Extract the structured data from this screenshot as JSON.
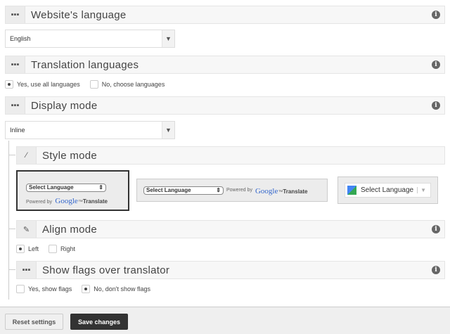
{
  "sections": {
    "website_language": {
      "title": "Website's language",
      "value": "English"
    },
    "translation_languages": {
      "title": "Translation languages",
      "options": [
        "Yes, use all languages",
        "No, choose languages"
      ]
    },
    "display_mode": {
      "title": "Display mode",
      "value": "Inline"
    },
    "style_mode": {
      "title": "Style mode",
      "select_label": "Select Language",
      "powered_by": "Powered by",
      "google": "Google",
      "tm": "™",
      "translate": "Translate"
    },
    "align_mode": {
      "title": "Align mode",
      "options": [
        "Left",
        "Right"
      ]
    },
    "show_flags": {
      "title": "Show flags over translator",
      "options": [
        "Yes, show flags",
        "No, don't show flags"
      ]
    }
  },
  "footer": {
    "reset": "Reset settings",
    "save": "Save changes"
  }
}
